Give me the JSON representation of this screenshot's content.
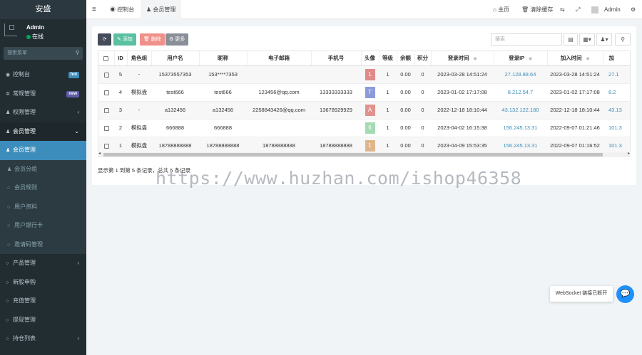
{
  "app": {
    "logo": "安盛"
  },
  "user": {
    "name": "Admin",
    "status": "在线"
  },
  "sidebar": {
    "search_placeholder": "搜索菜单",
    "items": [
      {
        "label": "控制台",
        "badge": "hot",
        "badge_color": "#3c8dbc"
      },
      {
        "label": "常规管理",
        "badge": "new",
        "badge_color": "#605ca8"
      },
      {
        "label": "权限管理"
      },
      {
        "label": "会员管理"
      },
      {
        "label": "会员管理"
      },
      {
        "label": "会员分组"
      },
      {
        "label": "会员规则"
      },
      {
        "label": "用户资料"
      },
      {
        "label": "用户银行卡"
      },
      {
        "label": "邀请码管理"
      },
      {
        "label": "产品管理"
      },
      {
        "label": "新股申购"
      },
      {
        "label": "充值管理"
      },
      {
        "label": "提现管理"
      },
      {
        "label": "持仓列表"
      }
    ]
  },
  "topbar": {
    "menu_icon": "≡",
    "tab_dashboard": "控制台",
    "tab_member": "会员管理",
    "home": "主页",
    "clear_cache": "清除缓存",
    "admin": "Admin"
  },
  "toolbar": {
    "refresh": "⟳",
    "add": "添加",
    "delete": "删除",
    "more": "更多",
    "search_placeholder": "搜索"
  },
  "table": {
    "headers": [
      "ID",
      "角色组",
      "用户名",
      "昵称",
      "电子邮箱",
      "手机号",
      "头像",
      "等级",
      "余额",
      "积分",
      "登录时间",
      "登录IP",
      "加入时间",
      "加"
    ],
    "rows": [
      {
        "id": "5",
        "group": "-",
        "username": "15373557353",
        "nickname": "153****7353",
        "email": "",
        "phone": "",
        "avatar": "1",
        "avatar_color": "#e08a8a",
        "level": "1",
        "balance": "0.00",
        "score": "0",
        "logintime": "2023-03-28 14:51:24",
        "loginip": "27.128.88.64",
        "jointime": "2023-03-28 14:51:24",
        "joinip": "27.1"
      },
      {
        "id": "4",
        "group": "模拟盘",
        "username": "test666",
        "nickname": "test666",
        "email": "123456@qq.com",
        "phone": "13333333333",
        "avatar": "T",
        "avatar_color": "#8c9bd9",
        "level": "1",
        "balance": "0.00",
        "score": "0",
        "logintime": "2023-01-02 17:17:08",
        "loginip": "8.212.54.7",
        "jointime": "2023-01-02 17:17:08",
        "joinip": "8.2"
      },
      {
        "id": "3",
        "group": "-",
        "username": "a132456",
        "nickname": "a132456",
        "email": "2258843426@qq.com",
        "phone": "13678929929",
        "avatar": "A",
        "avatar_color": "#e2928c",
        "level": "1",
        "balance": "0.00",
        "score": "0",
        "logintime": "2022-12-18 18:10:44",
        "loginip": "43.132.122.180",
        "jointime": "2022-12-18 18:10:44",
        "joinip": "43.13"
      },
      {
        "id": "2",
        "group": "模拟盘",
        "username": "666888",
        "nickname": "666888",
        "email": "",
        "phone": "",
        "avatar": "6",
        "avatar_color": "#a4dbb3",
        "level": "1",
        "balance": "0.00",
        "score": "0",
        "logintime": "2023-04-02 16:15:38",
        "loginip": "156.245.13.31",
        "jointime": "2022-09-07 01:21:46",
        "joinip": "101.3"
      },
      {
        "id": "1",
        "group": "模拟盘",
        "username": "18788888888",
        "nickname": "18788888888",
        "email": "18788888888",
        "phone": "18788888888",
        "avatar": "1",
        "avatar_color": "#e0b58c",
        "level": "1",
        "balance": "0.00",
        "score": "0",
        "logintime": "2023-04-09 15:53:35",
        "loginip": "156.245.13.31",
        "jointime": "2022-09-07 01:16:52",
        "joinip": "101.3"
      }
    ]
  },
  "pagination": {
    "info": "显示第 1 到第 5 条记录，总共 5 条记录"
  },
  "watermark": "https://www.huzhan.com/ishop46358",
  "toast": "WebSocket 链接已断开",
  "colors": {
    "sidebar": "#222d32",
    "accent": "#3c8dbc",
    "refresh": "#444c59",
    "add": "#5bc0a1",
    "delete": "#f0908a",
    "more": "#8a8f97"
  }
}
